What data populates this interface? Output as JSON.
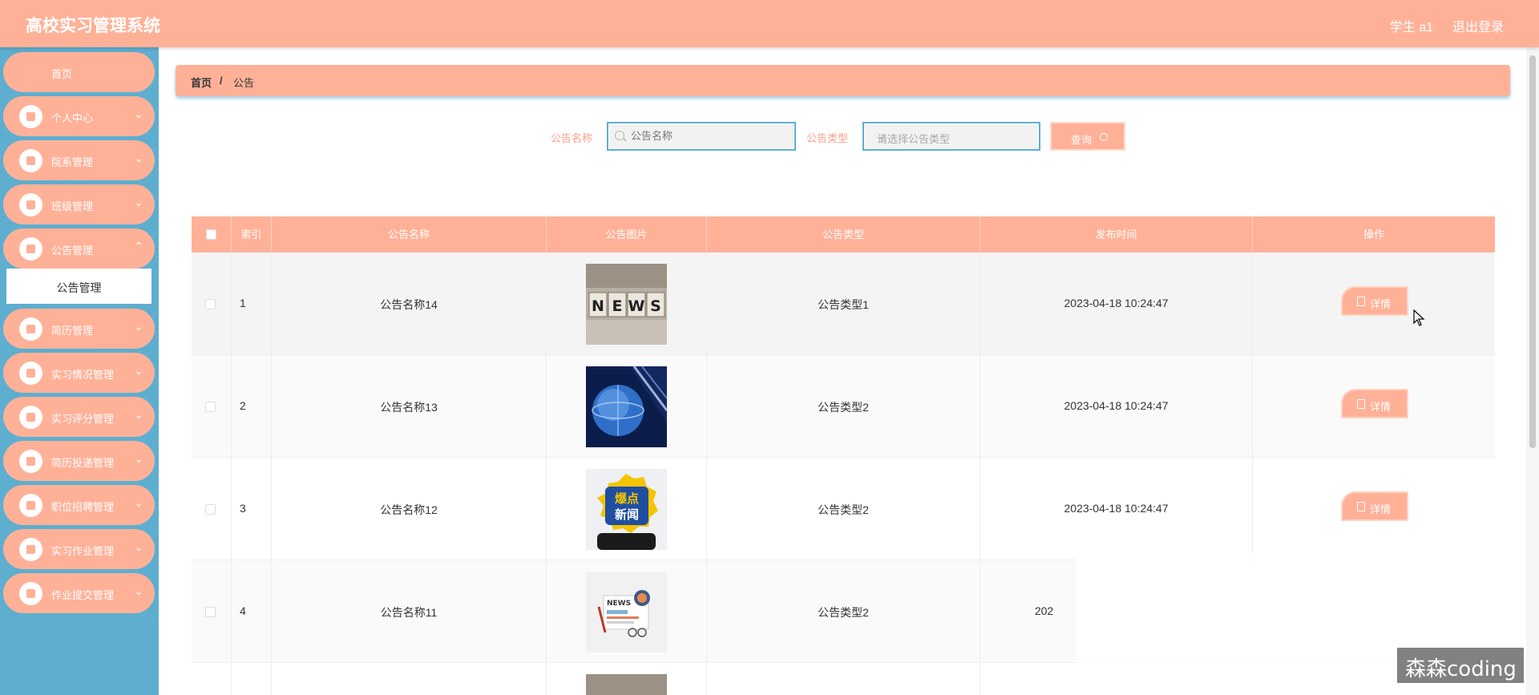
{
  "header": {
    "title": "高校实习管理系统",
    "user": "学生 a1",
    "logout": "退出登录"
  },
  "sidebar": {
    "items": [
      {
        "label": "首页",
        "icon": "home-icon"
      },
      {
        "label": "个人中心",
        "icon": "user-icon"
      },
      {
        "label": "院系管理",
        "icon": "building-icon"
      },
      {
        "label": "班级管理",
        "icon": "monitor-icon"
      },
      {
        "label": "公告管理",
        "icon": "grid-icon"
      },
      {
        "label": "简历管理",
        "icon": "grid-icon"
      },
      {
        "label": "实习情况管理",
        "icon": "sign-icon"
      },
      {
        "label": "实习评分管理",
        "icon": "grid-icon"
      },
      {
        "label": "简历投递管理",
        "icon": "grid-icon"
      },
      {
        "label": "职位招聘管理",
        "icon": "send-icon"
      },
      {
        "label": "实习作业管理",
        "icon": "grid-icon"
      },
      {
        "label": "作业提交管理",
        "icon": "monitor-icon"
      }
    ],
    "submenu": "公告管理"
  },
  "breadcrumb": {
    "home": "首页",
    "sep": "/",
    "current": "公告"
  },
  "search": {
    "name_label": "公告名称",
    "name_placeholder": "公告名称",
    "type_label": "公告类型",
    "type_placeholder": "请选择公告类型",
    "query_label": "查询"
  },
  "table": {
    "headers": [
      "索引",
      "公告名称",
      "公告图片",
      "公告类型",
      "发布时间",
      "操作"
    ],
    "rows": [
      {
        "index": "1",
        "name": "公告名称14",
        "type": "公告类型1",
        "time": "2023-04-18 10:24:47",
        "action": "详情",
        "image": "news-blocks"
      },
      {
        "index": "2",
        "name": "公告名称13",
        "type": "公告类型2",
        "time": "2023-04-18 10:24:47",
        "action": "详情",
        "image": "globe"
      },
      {
        "index": "3",
        "name": "公告名称12",
        "type": "公告类型2",
        "time": "2023-04-18 10:24:47",
        "action": "详情",
        "image": "badge-news"
      },
      {
        "index": "4",
        "name": "公告名称11",
        "type": "公告类型2",
        "time": "",
        "action": "",
        "image": "newspaper"
      }
    ]
  },
  "watermark": "森森coding",
  "colors": {
    "accent": "#ffb198",
    "sidebar": "#5eaed0"
  }
}
